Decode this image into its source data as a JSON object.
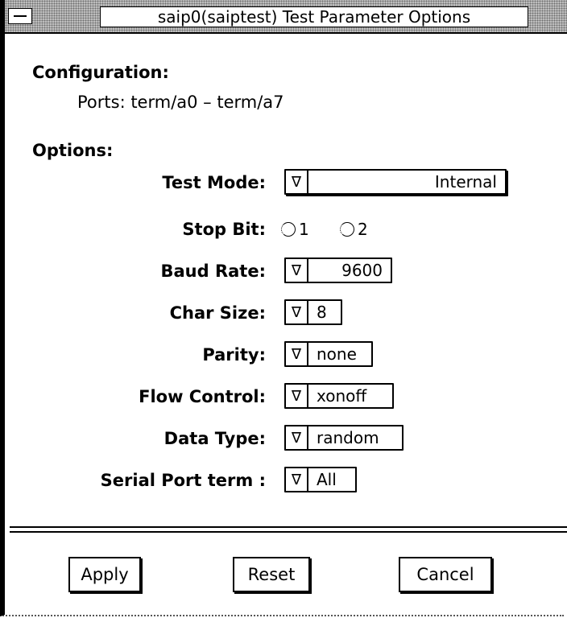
{
  "window": {
    "title": "saip0(saiptest) Test Parameter Options"
  },
  "configuration": {
    "heading": "Configuration:",
    "ports": "Ports: term/a0 – term/a7"
  },
  "options": {
    "heading": "Options:",
    "test_mode": {
      "label": "Test Mode:",
      "value": "Internal"
    },
    "stop_bit": {
      "label": "Stop Bit:",
      "opt1": "1",
      "opt2": "2"
    },
    "baud_rate": {
      "label": "Baud Rate:",
      "value": "9600"
    },
    "char_size": {
      "label": "Char Size:",
      "value": "8"
    },
    "parity": {
      "label": "Parity:",
      "value": "none"
    },
    "flow_control": {
      "label": "Flow Control:",
      "value": "xonoff"
    },
    "data_type": {
      "label": "Data Type:",
      "value": "random"
    },
    "serial_port": {
      "label": "Serial Port term :",
      "value": "All"
    }
  },
  "buttons": {
    "apply": "Apply",
    "reset": "Reset",
    "cancel": "Cancel"
  },
  "icons": {
    "dropdown": "∇",
    "menu": "window-menu-icon"
  }
}
